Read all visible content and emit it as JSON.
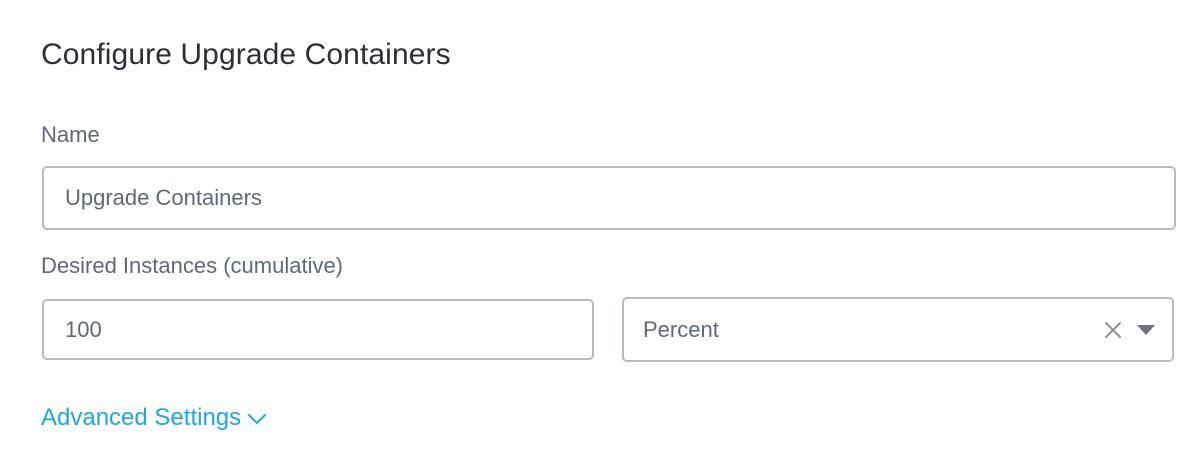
{
  "dialog": {
    "title": "Configure Upgrade Containers"
  },
  "fields": {
    "name_label": "Name",
    "name_value": "Upgrade Containers",
    "instances_label": "Desired Instances (cumulative)",
    "instances_value": "100",
    "unit_selected": "Percent"
  },
  "links": {
    "advanced_settings": "Advanced Settings"
  },
  "icons": {
    "clear": "close-icon",
    "select_caret": "caret-down-icon",
    "advanced_toggle": "chevron-down-icon"
  },
  "colors": {
    "title": "#2b2f36",
    "label": "#5e6977",
    "border": "#b6bbc3",
    "link": "#1ea7e4"
  }
}
